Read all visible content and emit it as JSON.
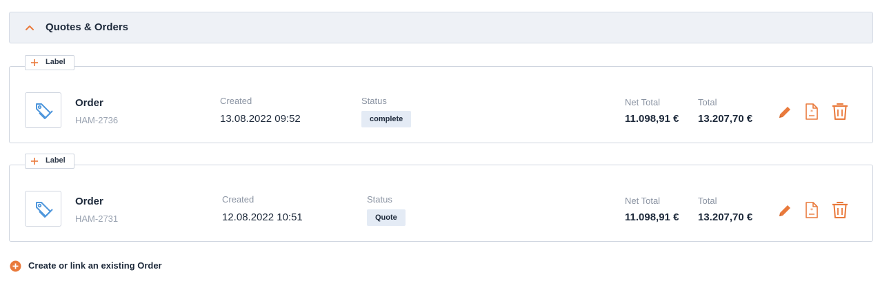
{
  "section": {
    "title": "Quotes & Orders",
    "collapse_icon": "chevron-up-icon"
  },
  "colors": {
    "accent": "#e97a3c",
    "icon_blue": "#4f97dc",
    "badge_bg": "#e4ebf5",
    "header_bg": "#eef1f6"
  },
  "orders": [
    {
      "label_button": "Label",
      "title": "Order",
      "number": "HAM-2736",
      "created_label": "Created",
      "created": "13.08.2022 09:52",
      "status_label": "Status",
      "status": "complete",
      "net_total_label": "Net Total",
      "net_total": "11.098,91 €",
      "total_label": "Total",
      "total": "13.207,70 €"
    },
    {
      "label_button": "Label",
      "title": "Order",
      "number": "HAM-2731",
      "created_label": "Created",
      "created": "12.08.2022 10:51",
      "status_label": "Status",
      "status": "Quote",
      "net_total_label": "Net Total",
      "net_total": "11.098,91 €",
      "total_label": "Total",
      "total": "13.207,70 €"
    }
  ],
  "create_link": {
    "label": "Create or link an existing Order"
  }
}
